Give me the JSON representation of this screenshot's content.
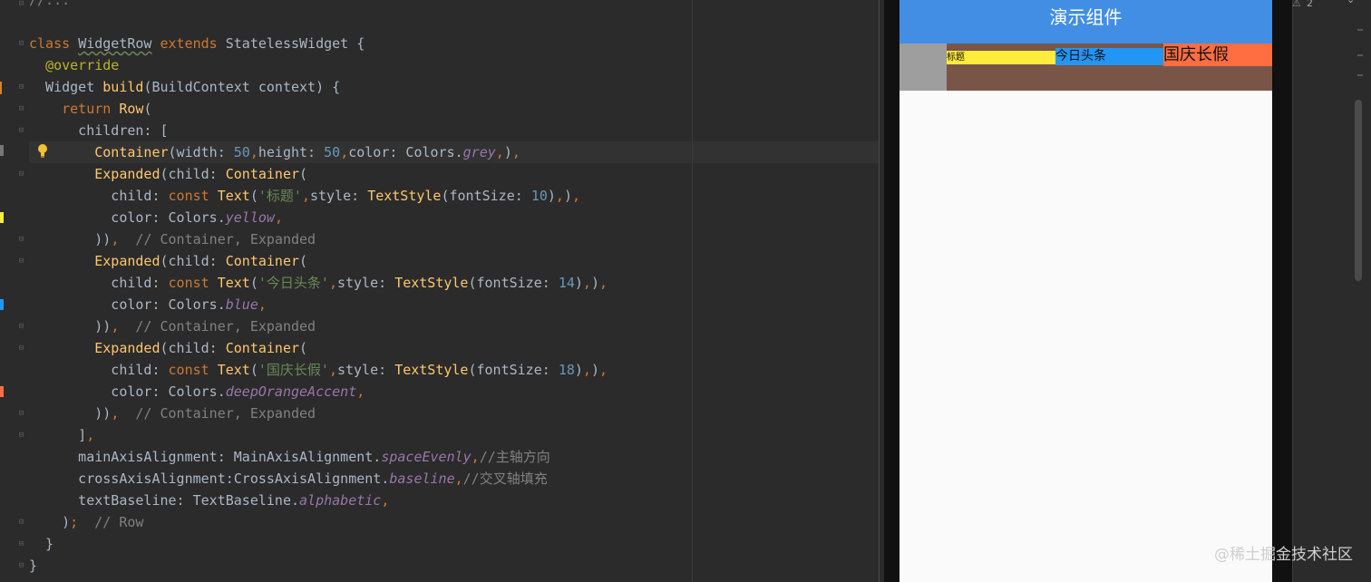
{
  "editor": {
    "lines": [
      {
        "segments": [
          {
            "t": "//...",
            "c": "cmt"
          }
        ]
      },
      {
        "segments": []
      },
      {
        "segments": [
          {
            "t": "class ",
            "c": "kw"
          },
          {
            "t": "WidgetRow",
            "c": "wavy"
          },
          {
            "t": " extends ",
            "c": "kw"
          },
          {
            "t": "StatelessWidget {",
            "c": ""
          }
        ]
      },
      {
        "segments": [
          {
            "t": "  "
          },
          {
            "t": "@override",
            "c": "ann"
          }
        ]
      },
      {
        "segments": [
          {
            "t": "  Widget "
          },
          {
            "t": "build",
            "c": "cls"
          },
          {
            "t": "(BuildContext context) {"
          }
        ]
      },
      {
        "segments": [
          {
            "t": "    "
          },
          {
            "t": "return ",
            "c": "kw"
          },
          {
            "t": "Row",
            "c": "cls"
          },
          {
            "t": "("
          }
        ]
      },
      {
        "segments": [
          {
            "t": "      children: ["
          }
        ]
      },
      {
        "segments": [
          {
            "t": "        "
          },
          {
            "t": "Container",
            "c": "cls"
          },
          {
            "t": "(width: "
          },
          {
            "t": "50",
            "c": "num"
          },
          {
            "t": ",",
            "c": "kw"
          },
          {
            "t": "height: "
          },
          {
            "t": "50",
            "c": "num"
          },
          {
            "t": ",",
            "c": "kw"
          },
          {
            "t": "color: Colors."
          },
          {
            "t": "grey",
            "c": "fld"
          },
          {
            "t": ",",
            "c": "kw"
          },
          {
            "t": ")"
          },
          {
            "t": ",",
            "c": "kw"
          }
        ]
      },
      {
        "segments": [
          {
            "t": "        "
          },
          {
            "t": "Expanded",
            "c": "cls"
          },
          {
            "t": "(child: "
          },
          {
            "t": "Container",
            "c": "cls"
          },
          {
            "t": "("
          }
        ]
      },
      {
        "segments": [
          {
            "t": "          child: "
          },
          {
            "t": "const ",
            "c": "kw"
          },
          {
            "t": "Text",
            "c": "cls"
          },
          {
            "t": "("
          },
          {
            "t": "'标题'",
            "c": "str"
          },
          {
            "t": ",",
            "c": "kw"
          },
          {
            "t": "style: "
          },
          {
            "t": "TextStyle",
            "c": "cls"
          },
          {
            "t": "(fontSize: "
          },
          {
            "t": "10",
            "c": "num"
          },
          {
            "t": ")"
          },
          {
            "t": ",",
            "c": "kw"
          },
          {
            "t": ")"
          },
          {
            "t": ",",
            "c": "kw"
          }
        ]
      },
      {
        "segments": [
          {
            "t": "          color: Colors."
          },
          {
            "t": "yellow",
            "c": "fld"
          },
          {
            "t": ",",
            "c": "kw"
          }
        ]
      },
      {
        "segments": [
          {
            "t": "        ))"
          },
          {
            "t": ",",
            "c": "kw"
          },
          {
            "t": "  // Container, Expanded",
            "c": "cmt"
          }
        ]
      },
      {
        "segments": [
          {
            "t": "        "
          },
          {
            "t": "Expanded",
            "c": "cls"
          },
          {
            "t": "(child: "
          },
          {
            "t": "Container",
            "c": "cls"
          },
          {
            "t": "("
          }
        ]
      },
      {
        "segments": [
          {
            "t": "          child: "
          },
          {
            "t": "const ",
            "c": "kw"
          },
          {
            "t": "Text",
            "c": "cls"
          },
          {
            "t": "("
          },
          {
            "t": "'今日头条'",
            "c": "str"
          },
          {
            "t": ",",
            "c": "kw"
          },
          {
            "t": "style: "
          },
          {
            "t": "TextStyle",
            "c": "cls"
          },
          {
            "t": "(fontSize: "
          },
          {
            "t": "14",
            "c": "num"
          },
          {
            "t": ")"
          },
          {
            "t": ",",
            "c": "kw"
          },
          {
            "t": ")"
          },
          {
            "t": ",",
            "c": "kw"
          }
        ]
      },
      {
        "segments": [
          {
            "t": "          color: Colors."
          },
          {
            "t": "blue",
            "c": "fld"
          },
          {
            "t": ",",
            "c": "kw"
          }
        ]
      },
      {
        "segments": [
          {
            "t": "        ))"
          },
          {
            "t": ",",
            "c": "kw"
          },
          {
            "t": "  // Container, Expanded",
            "c": "cmt"
          }
        ]
      },
      {
        "segments": [
          {
            "t": "        "
          },
          {
            "t": "Expanded",
            "c": "cls"
          },
          {
            "t": "(child: "
          },
          {
            "t": "Container",
            "c": "cls"
          },
          {
            "t": "("
          }
        ]
      },
      {
        "segments": [
          {
            "t": "          child: "
          },
          {
            "t": "const ",
            "c": "kw"
          },
          {
            "t": "Text",
            "c": "cls"
          },
          {
            "t": "("
          },
          {
            "t": "'国庆长假'",
            "c": "str"
          },
          {
            "t": ",",
            "c": "kw"
          },
          {
            "t": "style: "
          },
          {
            "t": "TextStyle",
            "c": "cls"
          },
          {
            "t": "(fontSize: "
          },
          {
            "t": "18",
            "c": "num"
          },
          {
            "t": ")"
          },
          {
            "t": ",",
            "c": "kw"
          },
          {
            "t": ")"
          },
          {
            "t": ",",
            "c": "kw"
          }
        ]
      },
      {
        "segments": [
          {
            "t": "          color: Colors."
          },
          {
            "t": "deepOrangeAccent",
            "c": "fld"
          },
          {
            "t": ",",
            "c": "kw"
          }
        ]
      },
      {
        "segments": [
          {
            "t": "        ))"
          },
          {
            "t": ",",
            "c": "kw"
          },
          {
            "t": "  // Container, Expanded",
            "c": "cmt"
          }
        ]
      },
      {
        "segments": [
          {
            "t": "      ]"
          },
          {
            "t": ",",
            "c": "kw"
          }
        ]
      },
      {
        "segments": [
          {
            "t": "      mainAxisAlignment: MainAxisAlignment."
          },
          {
            "t": "spaceEvenly",
            "c": "fld"
          },
          {
            "t": ",",
            "c": "kw"
          },
          {
            "t": "//主轴方向",
            "c": "cmt"
          }
        ]
      },
      {
        "segments": [
          {
            "t": "      crossAxisAlignment:CrossAxisAlignment."
          },
          {
            "t": "baseline",
            "c": "fld"
          },
          {
            "t": ",",
            "c": "kw"
          },
          {
            "t": "//交叉轴填充",
            "c": "cmt"
          }
        ]
      },
      {
        "segments": [
          {
            "t": "      textBaseline: TextBaseline."
          },
          {
            "t": "alphabetic",
            "c": "fld"
          },
          {
            "t": ",",
            "c": "kw"
          }
        ]
      },
      {
        "segments": [
          {
            "t": "    )"
          },
          {
            "t": ";",
            "c": "kw"
          },
          {
            "t": "  // Row",
            "c": "cmt"
          }
        ]
      },
      {
        "segments": [
          {
            "t": "  }"
          }
        ]
      },
      {
        "segments": [
          {
            "t": "}"
          }
        ]
      }
    ]
  },
  "phone": {
    "appbar_title": "演示组件",
    "cell_1_text": "标题",
    "cell_2_text": "今日头条",
    "cell_3_text": "国庆长假",
    "colors": {
      "appbar": "#428ee5",
      "row_bg": "#795548",
      "grey": "#9e9e9e",
      "yellow": "#ffeb3b",
      "blue": "#2196f3",
      "orange": "#ff6e40"
    }
  },
  "toolbar": {
    "warning_count": "2",
    "warning_icon": "warning-icon",
    "collapse_icon": "chevron-up-icon",
    "expand_icon": "chevron-down-icon"
  },
  "watermark": "@稀土掘金技术社区"
}
